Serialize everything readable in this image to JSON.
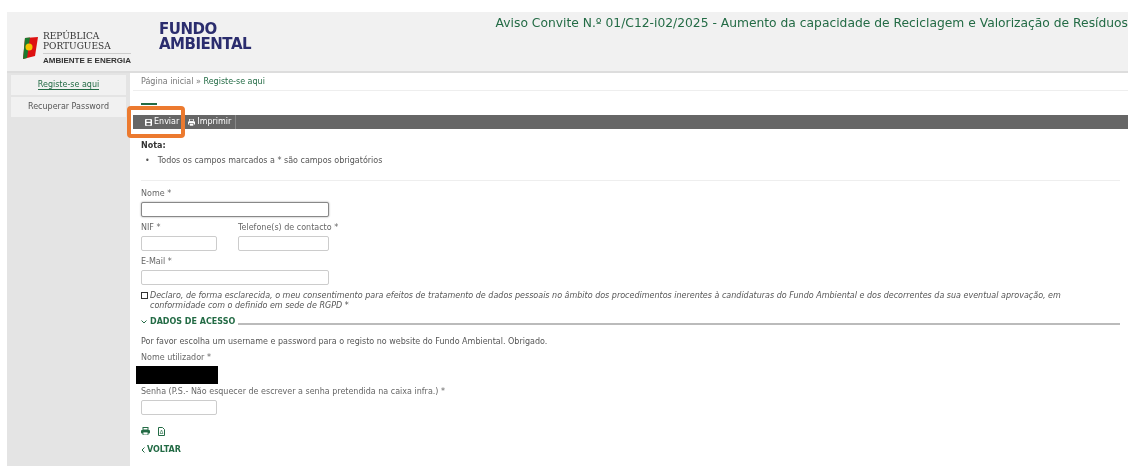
{
  "header": {
    "gov_logo_lines": [
      "REPÚBLICA",
      "PORTUGUESA"
    ],
    "gov_logo_subtitle": "AMBIENTE E ENERGIA",
    "brand_lines": [
      "FUNDO",
      "AMBIENTAL"
    ],
    "title": "Aviso Convite N.º 01/C12-i02/2025 - Aumento da capacidade de Reciclagem e Valorização de Resíduos"
  },
  "sidebar": {
    "items": [
      {
        "label": "Registe-se aqui",
        "selected": true
      },
      {
        "label": "Recuperar Password",
        "selected": false
      }
    ]
  },
  "breadcrumb": {
    "items": [
      "Página inicial",
      "Registe-se aqui"
    ],
    "separator": "»"
  },
  "toolbar": {
    "buttons": [
      {
        "label": "Enviar",
        "kind": "save",
        "highlighted": true
      },
      {
        "label": "Imprimir",
        "kind": "print",
        "highlighted": false
      }
    ]
  },
  "note": {
    "title": "Nota:",
    "bullet": "•",
    "items": [
      "Todos os campos marcados a * são campos obrigatórios"
    ]
  },
  "form": {
    "rows": [
      [
        {
          "label": "Nome *",
          "kind": "wide",
          "focused": true
        }
      ],
      [
        {
          "label": "NIF *",
          "kind": "short",
          "focused": false
        },
        {
          "label": "Telefone(s) de contacto *",
          "kind": "medium",
          "focused": false
        }
      ],
      [
        {
          "label": "E-Mail *",
          "kind": "wide",
          "focused": false
        }
      ]
    ]
  },
  "consent": {
    "checked": false,
    "text": "Declaro, de forma esclarecida, o meu consentimento para efeitos de tratamento de dados pessoais no âmbito dos procedimentos inerentes à candidaturas do Fundo Ambiental e dos decorrentes da sua eventual aprovação, em conformidade com o definido em sede de RGPD *"
  },
  "access_section": {
    "title": "DADOS DE ACESSO",
    "expanded": true,
    "intro": "Por favor escolha um username e password para o registo no website do Fundo Ambiental. Obrigado.",
    "fields": [
      {
        "label": "Nome utilizador *",
        "redacted": true
      },
      {
        "label": "Senha (P.S.- Não esquecer de escrever a senha pretendida na caixa infra.) *",
        "redacted": false
      }
    ]
  },
  "back_link": "VOLTAR"
}
